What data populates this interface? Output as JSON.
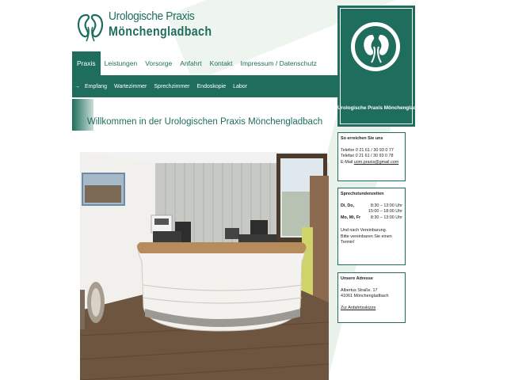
{
  "logo": {
    "line1": "Urologische Praxis",
    "line2": "Mönchengladbach"
  },
  "topnav": [
    {
      "label": "Praxis",
      "active": true
    },
    {
      "label": "Leistungen"
    },
    {
      "label": "Vorsorge"
    },
    {
      "label": "Anfahrt"
    },
    {
      "label": "Kontakt"
    },
    {
      "label": "Impressum / Datenschutz"
    }
  ],
  "subnav": {
    "arrow": "→",
    "items": [
      "Empfang",
      "Wartezimmer",
      "Sprechzimmer",
      "Endoskopie",
      "Labor"
    ]
  },
  "welcome": "Willkommen in der Urologischen Praxis Mönchengladbach",
  "side_logo_text": "Urologische Praxis Mönchengladbach",
  "contact": {
    "title": "So erreichen Sie uns",
    "phone": "Telefon 0 21 61 / 30 93 0 77",
    "fax": "Telefax 0 21 61 / 30 93 0 78",
    "email_label": "E-Mail",
    "email": "uom.praxis@gmail.com"
  },
  "hours": {
    "title": "Sprechstundenzeiten",
    "rows": [
      {
        "day": "Di, Do,",
        "time": "8:30 – 13:00 Uhr"
      },
      {
        "day": "",
        "time": "15:00 – 18:00 Uhr"
      },
      {
        "day": "Mo, Mi, Fr",
        "time": "8:30 – 13:00 Uhr"
      }
    ],
    "note1": "Und nach Vereinbarung.",
    "note2": "Bitte vereinbaren Sie einen",
    "note3": "Termin!"
  },
  "address": {
    "title": "Unsere Adresse",
    "street": "Albertus Straße. 17",
    "city": "41061 Mönchengladbach",
    "link": "Zur Anfahrtsskizze"
  },
  "colors": {
    "brand": "#1f6e5d",
    "nav_text": "#ffffff"
  }
}
